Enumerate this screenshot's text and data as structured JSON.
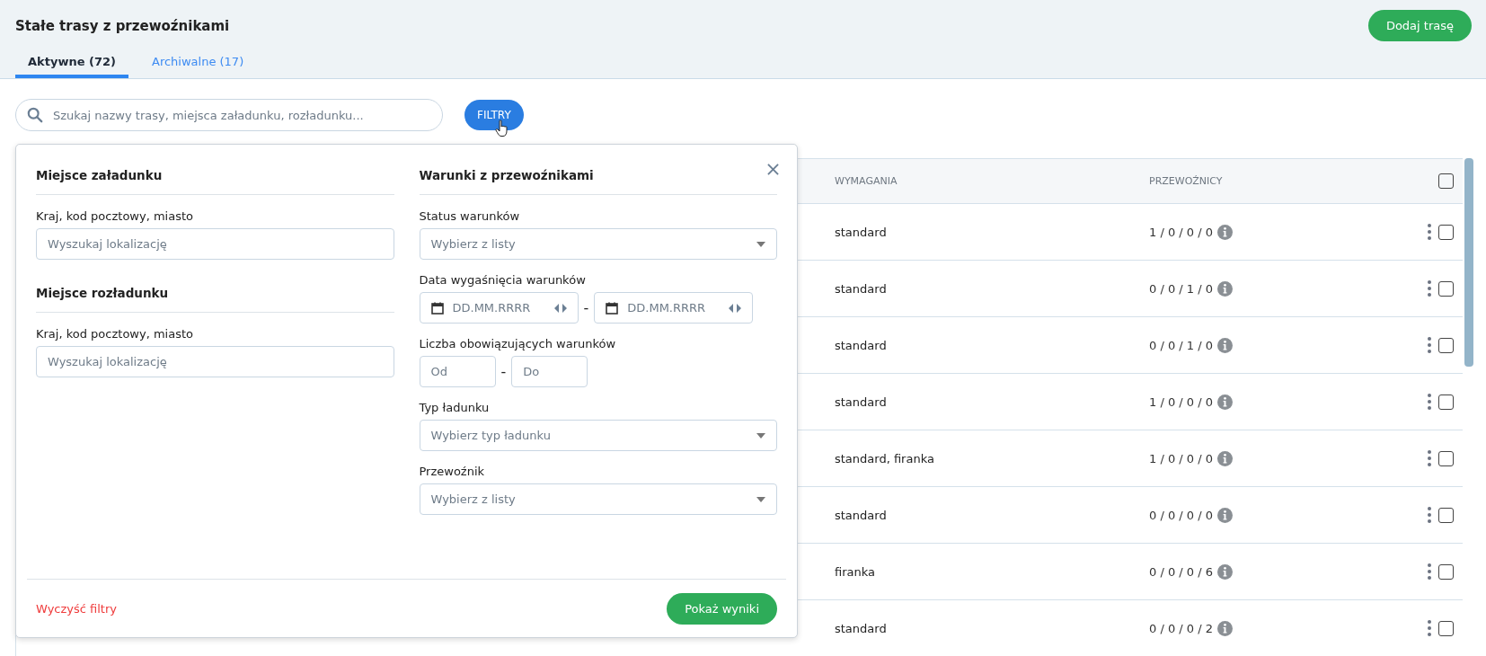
{
  "header": {
    "title": "Stałe trasy z przewoźnikami",
    "add_button": "Dodaj trasę"
  },
  "tabs": [
    {
      "label": "Aktywne (72)",
      "selected": true
    },
    {
      "label": "Archiwalne (17)",
      "selected": false
    }
  ],
  "search": {
    "placeholder": "Szukaj nazwy trasy, miejsca załadunku, rozładunku..."
  },
  "filters_button": "FILTRY",
  "filter_panel": {
    "loading": {
      "title": "Miejsce załadunku",
      "label": "Kraj, kod pocztowy, miasto",
      "placeholder": "Wyszukaj lokalizację"
    },
    "unloading": {
      "title": "Miejsce rozładunku",
      "label": "Kraj, kod pocztowy, miasto",
      "placeholder": "Wyszukaj lokalizację"
    },
    "conditions": {
      "title": "Warunki z przewoźnikami",
      "fields": [
        {
          "kind": "select",
          "label": "Status warunków",
          "placeholder": "Wybierz z listy"
        },
        {
          "kind": "daterange",
          "label": "Data wygaśnięcia warunków",
          "from": "DD.MM.RRRR",
          "separator": "-",
          "to": "DD.MM.RRRR"
        },
        {
          "kind": "range",
          "label": "Liczba obowiązujących warunków",
          "from_placeholder": "Od",
          "separator": "-",
          "to_placeholder": "Do"
        },
        {
          "kind": "select",
          "label": "Typ ładunku",
          "placeholder": "Wybierz typ ładunku"
        },
        {
          "kind": "select",
          "label": "Przewoźnik",
          "placeholder": "Wybierz z listy"
        }
      ]
    },
    "clear_link": "Wyczyść filtry",
    "submit_button": "Pokaż wyniki"
  },
  "table": {
    "columns": [
      "WYMAGANIA",
      "PRZEWOŹNICY"
    ],
    "header_checked": false,
    "rows": [
      {
        "requirements": "standard",
        "carriers": "1 / 0 / 0 / 0",
        "checked": false
      },
      {
        "requirements": "standard",
        "carriers": "0 / 0 / 1 / 0",
        "checked": false
      },
      {
        "requirements": "standard",
        "carriers": "0 / 0 / 1 / 0",
        "checked": false
      },
      {
        "requirements": "standard",
        "carriers": "1 / 0 / 0 / 0",
        "checked": false
      },
      {
        "requirements": "standard, firanka",
        "carriers": "1 / 0 / 0 / 0",
        "checked": false
      },
      {
        "requirements": "standard",
        "carriers": "0 / 0 / 0 / 0",
        "checked": false
      },
      {
        "requirements": "firanka",
        "carriers": "0 / 0 / 0 / 6",
        "checked": false
      },
      {
        "requirements": "standard",
        "carriers": "0 / 0 / 0 / 2",
        "checked": false
      }
    ]
  }
}
